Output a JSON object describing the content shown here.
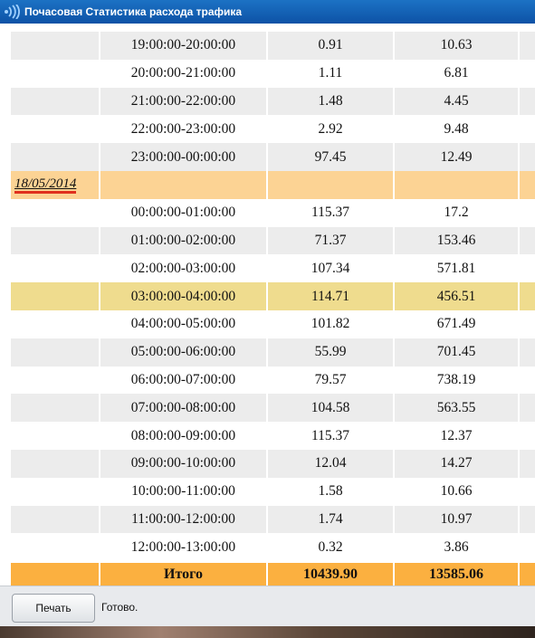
{
  "window": {
    "title": "Почасовая Статистика расхода трафика",
    "icon": "wifi-signal-icon"
  },
  "rows_before": [
    {
      "hour": "19:00:00-20:00:00",
      "v1": "0.91",
      "v2": "10.63"
    },
    {
      "hour": "20:00:00-21:00:00",
      "v1": "1.11",
      "v2": "6.81"
    },
    {
      "hour": "21:00:00-22:00:00",
      "v1": "1.48",
      "v2": "4.45"
    },
    {
      "hour": "22:00:00-23:00:00",
      "v1": "2.92",
      "v2": "9.48"
    },
    {
      "hour": "23:00:00-00:00:00",
      "v1": "97.45",
      "v2": "12.49"
    }
  ],
  "date_group": {
    "date": "18/05/2014"
  },
  "rows_after": [
    {
      "hour": "00:00:00-01:00:00",
      "v1": "115.37",
      "v2": "17.2"
    },
    {
      "hour": "01:00:00-02:00:00",
      "v1": "71.37",
      "v2": "153.46"
    },
    {
      "hour": "02:00:00-03:00:00",
      "v1": "107.34",
      "v2": "571.81"
    },
    {
      "hour": "03:00:00-04:00:00",
      "v1": "114.71",
      "v2": "456.51"
    },
    {
      "hour": "04:00:00-05:00:00",
      "v1": "101.82",
      "v2": "671.49"
    },
    {
      "hour": "05:00:00-06:00:00",
      "v1": "55.99",
      "v2": "701.45"
    },
    {
      "hour": "06:00:00-07:00:00",
      "v1": "79.57",
      "v2": "738.19"
    },
    {
      "hour": "07:00:00-08:00:00",
      "v1": "104.58",
      "v2": "563.55"
    },
    {
      "hour": "08:00:00-09:00:00",
      "v1": "115.37",
      "v2": "12.37"
    },
    {
      "hour": "09:00:00-10:00:00",
      "v1": "12.04",
      "v2": "14.27"
    },
    {
      "hour": "10:00:00-11:00:00",
      "v1": "1.58",
      "v2": "10.66"
    },
    {
      "hour": "11:00:00-12:00:00",
      "v1": "1.74",
      "v2": "10.97"
    },
    {
      "hour": "12:00:00-13:00:00",
      "v1": "0.32",
      "v2": "3.86"
    }
  ],
  "totals": {
    "label": "Итого",
    "v1": "10439.90",
    "v2": "13585.06"
  },
  "footer": {
    "print_button": "Печать",
    "status": "Готово."
  },
  "colors": {
    "title_bar": "#0d52a6",
    "date_row": "#fcd394",
    "highlight_row": "#efdc8e",
    "total_row": "#fbb040",
    "alt_row": "#ececec"
  }
}
